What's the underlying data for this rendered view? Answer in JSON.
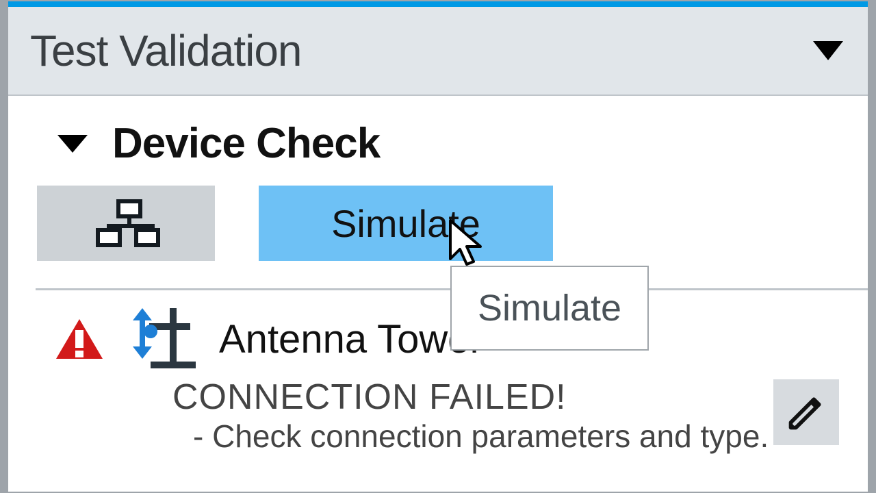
{
  "panel": {
    "title": "Test Validation"
  },
  "section": {
    "title": "Device Check"
  },
  "toolbar": {
    "simulate_label": "Simulate"
  },
  "tooltip": {
    "text": "Simulate"
  },
  "device": {
    "name": "Antenna Tower",
    "status_title": "CONNECTION FAILED!",
    "status_detail": "- Check connection parameters and type."
  },
  "colors": {
    "accent": "#0099e5",
    "hover": "#6ec1f5",
    "error": "#d21a1a"
  }
}
